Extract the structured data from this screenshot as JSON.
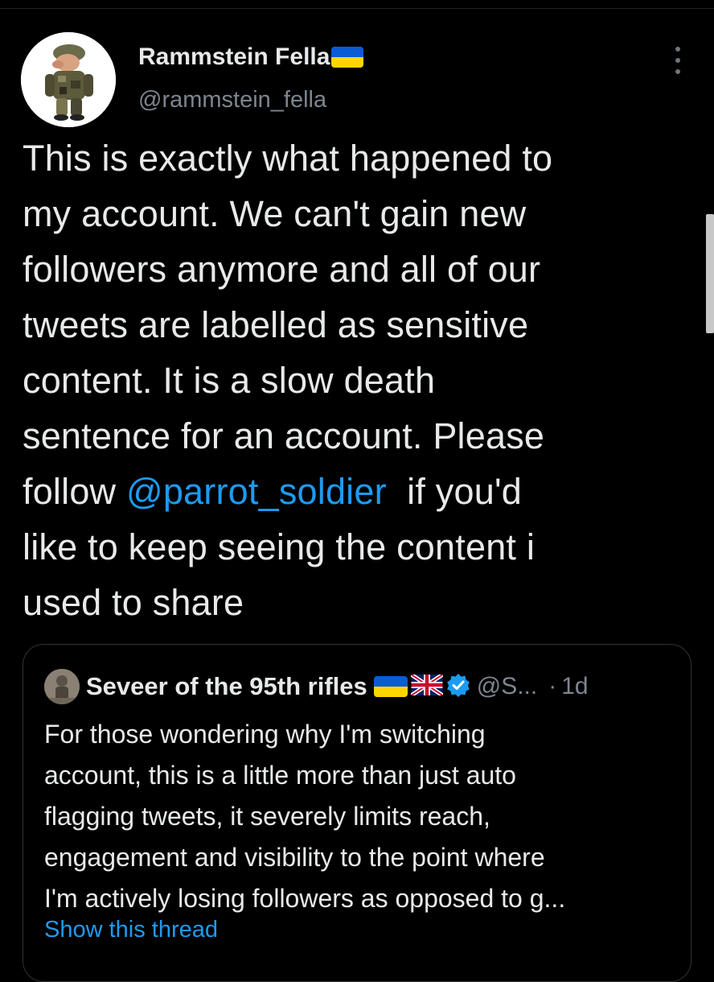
{
  "author": {
    "display_name": "Rammstein Fella",
    "handle": "@rammstein_fella",
    "flag_icon": "ukraine-flag"
  },
  "tweet": {
    "lines": [
      "This is exactly what happened to",
      "my account. We can't gain new",
      "followers anymore and all of our",
      "tweets are labelled as sensitive",
      "content. It is a slow death",
      "sentence for an account. Please"
    ],
    "line7_prefix": "follow ",
    "mention": "@parrot_soldier",
    "line7_suffix": "  if you'd",
    "line8": "like to keep seeing the content i",
    "line9": "used to share"
  },
  "quoted": {
    "display_name": "Seveer of the 95th rifles",
    "handle": "@S...",
    "separator": "·",
    "time": "1d",
    "lines": [
      "For those wondering why I'm switching",
      "account, this is a little more than just auto",
      "flagging tweets, it severely limits reach,",
      "engagement and visibility to the point where",
      "I'm actively losing followers as opposed to g..."
    ],
    "show_thread": "Show this thread"
  },
  "colors": {
    "background": "#000000",
    "text": "#e7e9ea",
    "secondary": "#7d8590",
    "link": "#1d9bf0"
  }
}
